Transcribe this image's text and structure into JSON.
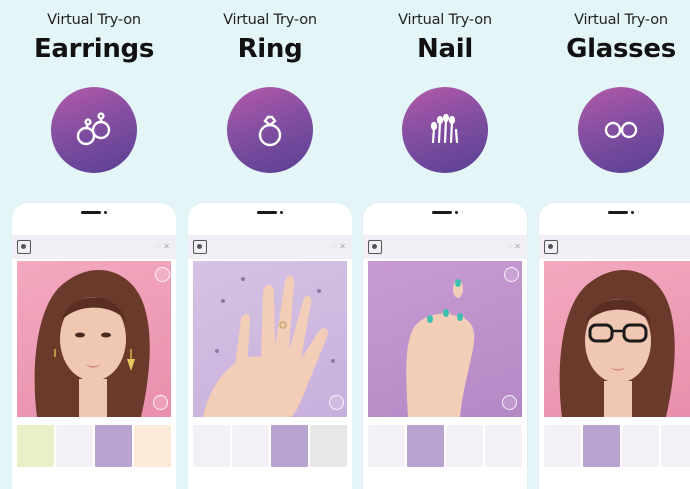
{
  "columns": [
    {
      "subtitle": "Virtual Try-on",
      "title": "Earrings",
      "icon": "earrings-icon"
    },
    {
      "subtitle": "Virtual Try-on",
      "title": "Ring",
      "icon": "ring-icon"
    },
    {
      "subtitle": "Virtual Try-on",
      "title": "Nail",
      "icon": "nail-icon"
    },
    {
      "subtitle": "Virtual Try-on",
      "title": "Glasses",
      "icon": "glasses-icon"
    }
  ],
  "colors": {
    "background": "#e4f5f8",
    "circle_top": "#b35aa8",
    "circle_bottom": "#5a3f93",
    "selected_thumb": "#b9a4d1"
  }
}
